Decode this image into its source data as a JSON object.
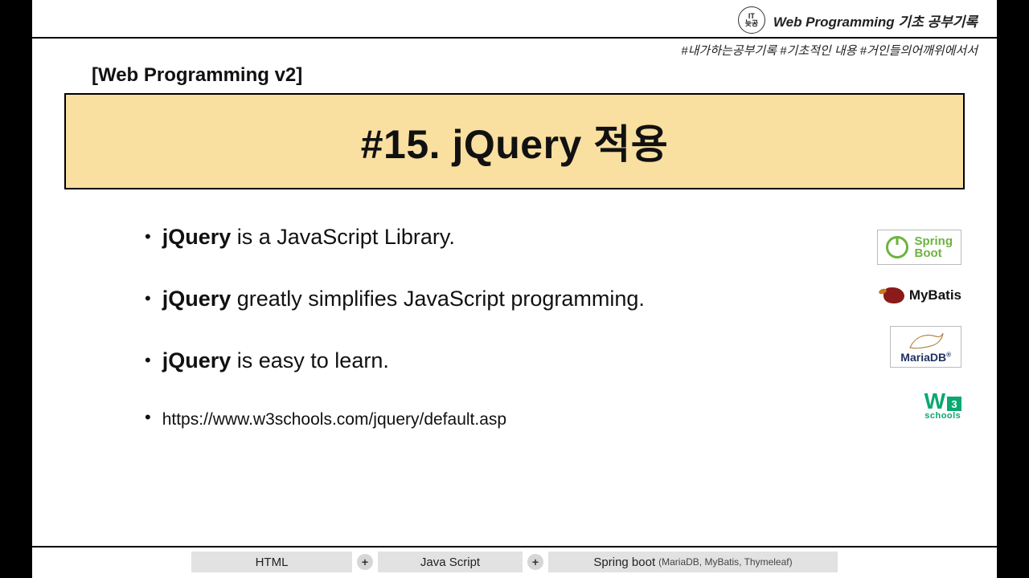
{
  "brand": {
    "circle_line1": "IT",
    "circle_line2": "늦공",
    "title_prefix": "Web Programming",
    "title_suffix": " 기초 공부기록"
  },
  "hashtags": "#내가하는공부기록  #기초적인 내용 #거인들의어깨위에서서",
  "section_label": "[Web Programming v2]",
  "main_title": "#15. jQuery 적용",
  "bullets": [
    {
      "bold": "jQuery",
      "rest": " is a JavaScript Library."
    },
    {
      "bold": "jQuery",
      "rest": " greatly simplifies JavaScript programming."
    },
    {
      "bold": "jQuery",
      "rest": " is easy to learn."
    }
  ],
  "link_bullet": "https://www.w3schools.com/jquery/default.asp",
  "logos": {
    "spring_line1": "Spring",
    "spring_line2": "Boot",
    "mybatis": "MyBatis",
    "mariadb": "MariaDB",
    "mariadb_r": "®",
    "w3_w": "W",
    "w3_3": "3",
    "w3_sub": "schools"
  },
  "nav": {
    "item1": "HTML",
    "item2": "Java Script",
    "item3": "Spring boot",
    "item3_sub": "(MariaDB, MyBatis, Thymeleaf)",
    "plus": "+"
  }
}
